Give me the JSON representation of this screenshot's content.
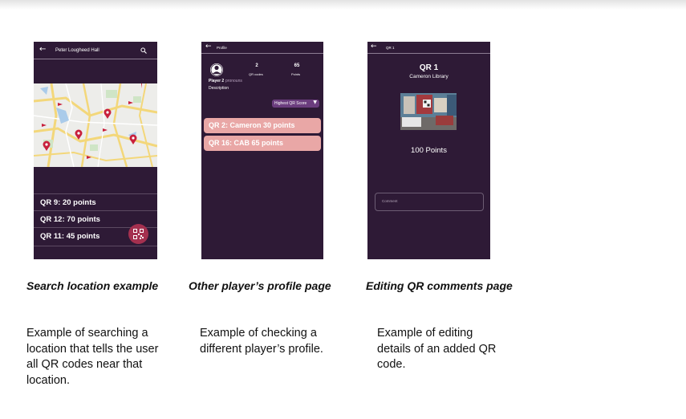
{
  "panels": [
    {
      "appbar_title": "Peter Lougheed Hall",
      "results": [
        {
          "label": "QR 9: 20 points"
        },
        {
          "label": "QR 12: 70 points"
        },
        {
          "label": "QR 11: 45 points"
        }
      ],
      "caption": "Search location example",
      "description": "Example of searching a location that tells the user all QR codes near that location."
    },
    {
      "appbar_title": "Profile",
      "stats": [
        {
          "value": "2",
          "label": "QR codes"
        },
        {
          "value": "65",
          "label": "Points"
        }
      ],
      "player_name": "Player 2",
      "pronouns": "pronouns",
      "description_label": "Description",
      "sort_label": "Highest QR Score",
      "qr_list": [
        {
          "label": "QR 2: Cameron  30 points"
        },
        {
          "label": "QR 16: CAB  65 points"
        }
      ],
      "caption": "Other player’s profile page",
      "description": "Example of checking a different player’s profile."
    },
    {
      "appbar_title": "QR 1",
      "qr_title": "QR 1",
      "location": "Cameron Library",
      "points": "100 Points",
      "comment_placeholder": "Comment",
      "caption": "Editing QR comments page",
      "description": "Example of editing details of an added QR code."
    }
  ],
  "colors": {
    "phone_bg": "#2e1a36",
    "accent_pink": "#e9a7a6",
    "sort_button": "#6b3d7e",
    "fab": "#a4304f",
    "map_pin": "#c8203c"
  },
  "icons": [
    "arrow-left-icon",
    "search-icon",
    "qr-code-icon",
    "user-icon",
    "triangle-down-icon",
    "map-pin-icon"
  ]
}
